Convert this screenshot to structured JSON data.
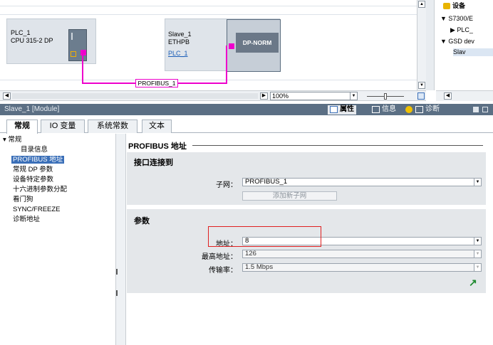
{
  "network": {
    "plc": {
      "name": "PLC_1",
      "type": "CPU 315-2 DP"
    },
    "slave": {
      "name": "Slave_1",
      "type": "ETHPB",
      "link": "PLC_1",
      "module": "DP-NORM"
    },
    "bus_label": "PROFIBUS_1",
    "zoom": "100%"
  },
  "tree": {
    "header": "设备",
    "items": [
      "S7300/E",
      "PLC_",
      "GSD dev",
      "Slav"
    ]
  },
  "header": {
    "title": "Slave_1 [Module]",
    "tabs": [
      "属性",
      "信息",
      "诊断"
    ]
  },
  "tabs": [
    "常规",
    "IO 变量",
    "系统常数",
    "文本"
  ],
  "nav": {
    "items": [
      "常规",
      "目录信息",
      "PROFIBUS 地址",
      "常规 DP 参数",
      "设备特定参数",
      "十六进制参数分配",
      "看门狗",
      "SYNC/FREEZE",
      "诊断地址"
    ]
  },
  "content": {
    "section_title": "PROFIBUS 地址",
    "interface": {
      "title": "接口连接到",
      "subnet_label": "子网：",
      "subnet_value": "PROFIBUS_1",
      "add_subnet": "添加新子网"
    },
    "params": {
      "title": "参数",
      "address_label": "地址：",
      "address_value": "8",
      "max_address_label": "最高地址：",
      "max_address_value": "126",
      "baud_label": "传输率：",
      "baud_value": "1.5 Mbps"
    }
  },
  "colors": {
    "bus": "#ee00cc",
    "selection": "#3a6fb8",
    "highlight": "#e02020",
    "header": "#5b6f84"
  }
}
